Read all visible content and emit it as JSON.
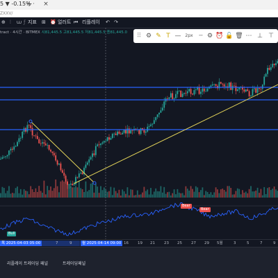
{
  "browser": {
    "tab_title": "5 ▼ -0.15% ·",
    "close_glyph": "×",
    "new_tab_glyph": "+",
    "url": "ZXXV/"
  },
  "toolbar": {
    "indicators_label": "지표",
    "alerts_label": "얼러트",
    "replay_label": "리플레이"
  },
  "legend": {
    "symbol_text": "tract · 4시간 · BITMEX",
    "ohlc": "시81,445.5  고81,445.5  저81,445.5  종81,445.0"
  },
  "drawing_toolbar": {
    "line_width_label": "2px"
  },
  "time_axis": {
    "ticks": [
      "7",
      "9",
      "16",
      "19",
      "21",
      "23",
      "25",
      "27",
      "29",
      "5월",
      "3",
      "5",
      "7",
      "9"
    ],
    "start_label": "목 2025-04-03  05:00",
    "end_label": "월 2025-04-14  09:00"
  },
  "signals": {
    "bull_label": "Bull",
    "bear_labels": [
      "Bear",
      "Bear"
    ]
  },
  "bottom_panel": {
    "trading_panel_label": "리플레이 트레이딩 패널",
    "trading_panel_short_label": "트레이딩패널"
  },
  "chart_data": {
    "type": "candlestick",
    "title": "",
    "horizontal_levels_color": "#2962ff",
    "trendline_color": "#e6d65a",
    "up_color": "#26a69a",
    "down_color": "#ef5350",
    "oscillator_color": "#2962ff"
  }
}
